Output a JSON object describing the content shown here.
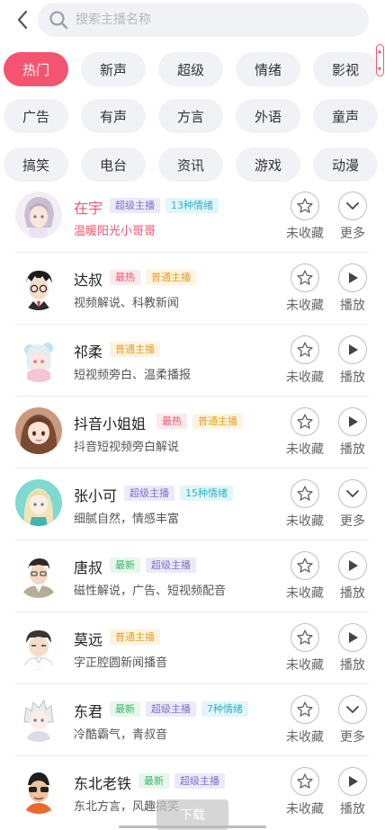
{
  "search": {
    "placeholder": "搜索主播名称"
  },
  "categories": [
    "热门",
    "新声",
    "超级",
    "情绪",
    "影视",
    "广告",
    "有声",
    "方言",
    "外语",
    "童声",
    "搞笑",
    "电台",
    "资讯",
    "游戏",
    "动漫"
  ],
  "active_category": "热门",
  "colors": {
    "accent": "#f4546f",
    "chip_bg": "#f1f2f5"
  },
  "anchors": [
    {
      "name": "在宇",
      "tags": [
        {
          "text": "超级主播",
          "type": "super"
        },
        {
          "text": "13种情绪",
          "type": "emotion"
        }
      ],
      "desc": "温暖阳光小哥哥",
      "fav": "未收藏",
      "action": "更多",
      "action_icon": "chevron-down-icon",
      "highlight": true
    },
    {
      "name": "达叔",
      "tags": [
        {
          "text": "最热",
          "type": "hot"
        },
        {
          "text": "普通主播",
          "type": "normal"
        }
      ],
      "desc": "视频解说、科教新闻",
      "fav": "未收藏",
      "action": "播放",
      "action_icon": "play-icon"
    },
    {
      "name": "祁柔",
      "tags": [
        {
          "text": "普通主播",
          "type": "normal"
        }
      ],
      "desc": "短视频旁白、温柔播报",
      "fav": "未收藏",
      "action": "播放",
      "action_icon": "play-icon"
    },
    {
      "name": "抖音小姐姐",
      "tags": [
        {
          "text": "最热",
          "type": "hot"
        },
        {
          "text": "普通主播",
          "type": "normal"
        }
      ],
      "desc": "抖音短视频旁白解说",
      "fav": "未收藏",
      "action": "播放",
      "action_icon": "play-icon"
    },
    {
      "name": "张小可",
      "tags": [
        {
          "text": "超级主播",
          "type": "super"
        },
        {
          "text": "15种情绪",
          "type": "emotion"
        }
      ],
      "desc": "细腻自然，情感丰富",
      "fav": "未收藏",
      "action": "更多",
      "action_icon": "chevron-down-icon"
    },
    {
      "name": "唐叔",
      "tags": [
        {
          "text": "最新",
          "type": "new"
        },
        {
          "text": "超级主播",
          "type": "super"
        }
      ],
      "desc": "磁性解说，广告、短视频配音",
      "fav": "未收藏",
      "action": "播放",
      "action_icon": "play-icon"
    },
    {
      "name": "莫远",
      "tags": [
        {
          "text": "普通主播",
          "type": "normal"
        }
      ],
      "desc": "字正腔圆新闻播音",
      "fav": "未收藏",
      "action": "播放",
      "action_icon": "play-icon"
    },
    {
      "name": "东君",
      "tags": [
        {
          "text": "最新",
          "type": "new"
        },
        {
          "text": "超级主播",
          "type": "super"
        },
        {
          "text": "7种情绪",
          "type": "emotion"
        }
      ],
      "desc": "冷酷霸气，青叔音",
      "fav": "未收藏",
      "action": "更多",
      "action_icon": "chevron-down-icon"
    },
    {
      "name": "东北老铁",
      "tags": [
        {
          "text": "最新",
          "type": "new"
        },
        {
          "text": "超级主播",
          "type": "super"
        }
      ],
      "desc": "东北方言，风趣搞笑",
      "fav": "未收藏",
      "action": "播放",
      "action_icon": "play-icon"
    }
  ],
  "download_label": "下载"
}
